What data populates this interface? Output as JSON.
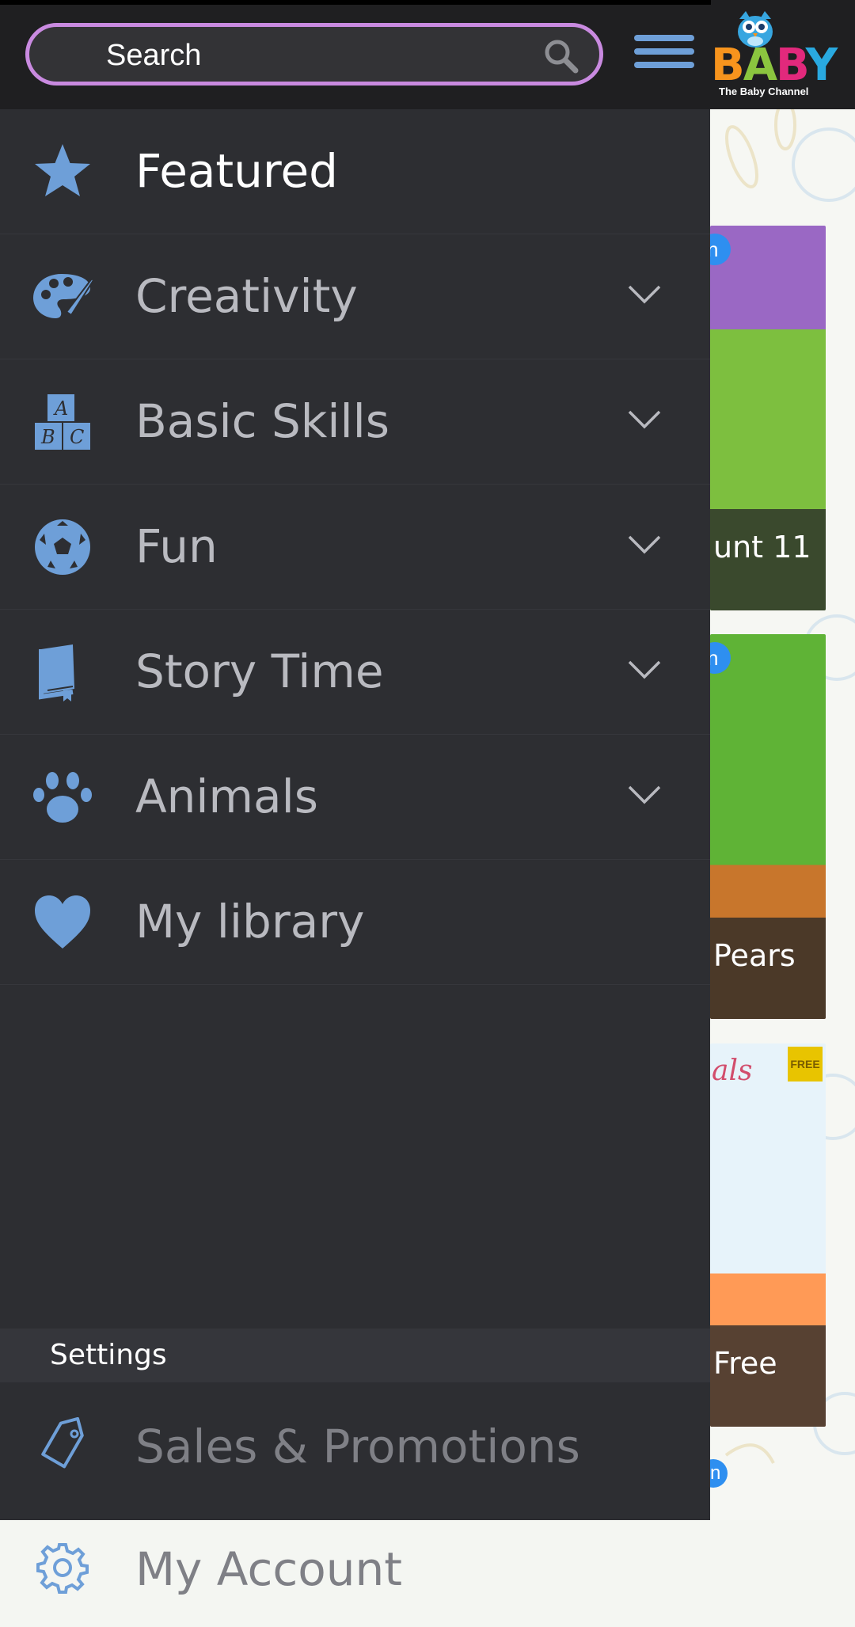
{
  "search": {
    "placeholder": "Search"
  },
  "logo": {
    "word_b1": "B",
    "word_a": "A",
    "word_b2": "B",
    "word_y": "Y",
    "tagline": "The Baby Channel"
  },
  "nav": {
    "items": [
      {
        "label": "Featured",
        "icon": "star-icon",
        "expandable": false,
        "active": true
      },
      {
        "label": "Creativity",
        "icon": "palette-icon",
        "expandable": true
      },
      {
        "label": "Basic Skills",
        "icon": "abc-blocks-icon",
        "expandable": true
      },
      {
        "label": "Fun",
        "icon": "soccer-ball-icon",
        "expandable": true
      },
      {
        "label": "Story Time",
        "icon": "book-icon",
        "expandable": true
      },
      {
        "label": "Animals",
        "icon": "paw-icon",
        "expandable": true
      },
      {
        "label": "My library",
        "icon": "heart-icon",
        "expandable": false
      }
    ]
  },
  "settings": {
    "header": "Settings",
    "items": [
      {
        "label": "Sales & Promotions",
        "icon": "tag-icon"
      },
      {
        "label": "My Account",
        "icon": "gear-icon"
      }
    ]
  },
  "background": {
    "cards": [
      {
        "caption": "unt 11",
        "badge": "n"
      },
      {
        "caption": "Pears",
        "badge": "n"
      },
      {
        "caption": "Free",
        "corner": "FREE",
        "script": "als"
      }
    ],
    "bottom_badge": "n"
  },
  "colors": {
    "accent_blue": "#6e9fd8",
    "search_border": "#c98ae0",
    "drawer_bg": "#2d2e32",
    "topbar_bg": "#1f1f21"
  }
}
